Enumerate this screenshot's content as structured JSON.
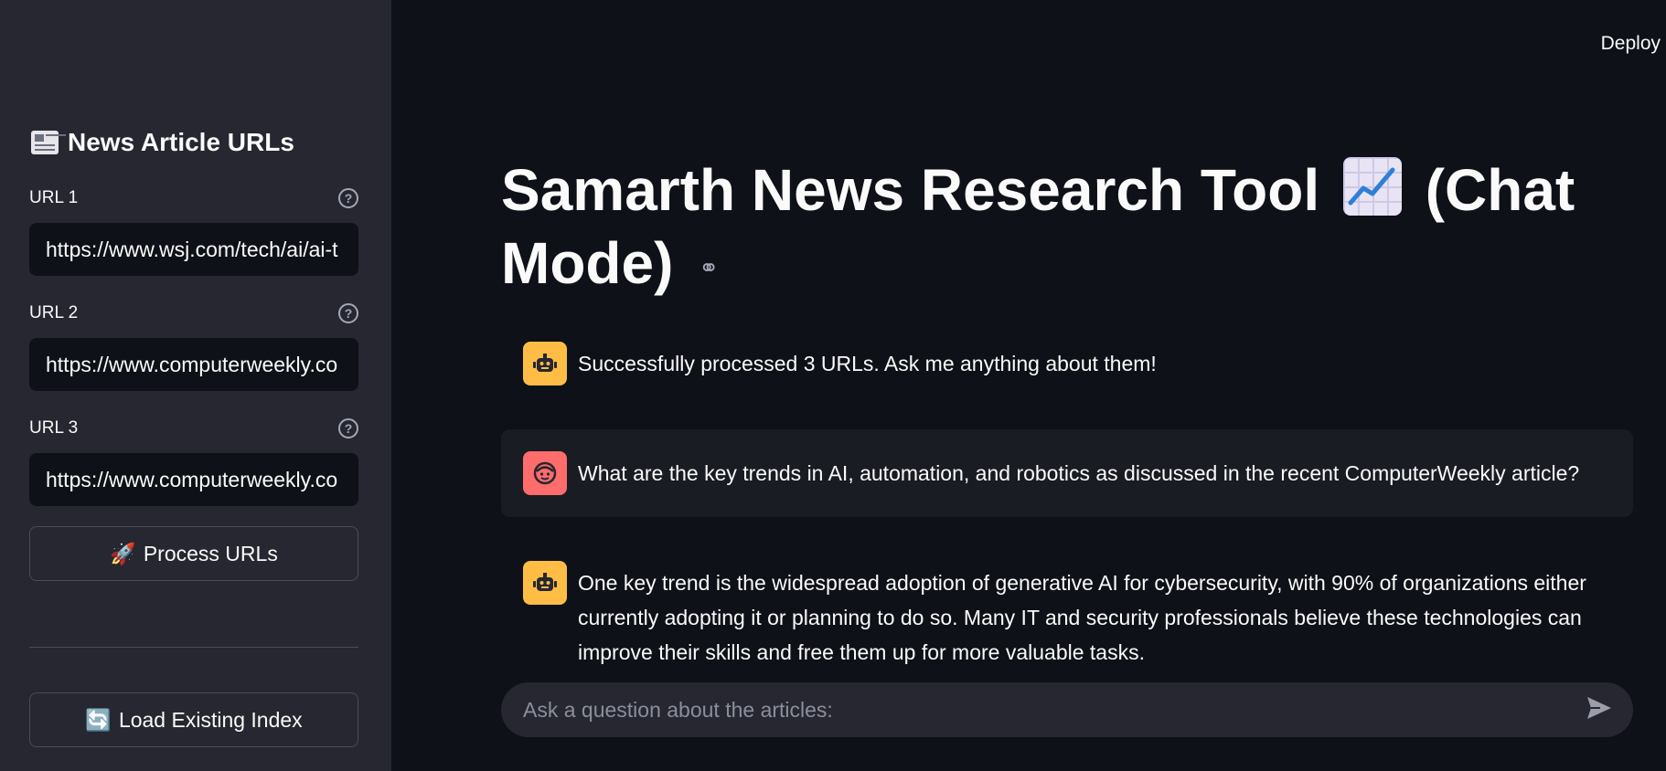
{
  "header": {
    "deploy_label": "Deploy"
  },
  "sidebar": {
    "title": "News Article URLs",
    "urls": [
      {
        "label": "URL 1",
        "value": "https://www.wsj.com/tech/ai/ai-t"
      },
      {
        "label": "URL 2",
        "value": "https://www.computerweekly.co"
      },
      {
        "label": "URL 3",
        "value": "https://www.computerweekly.co"
      }
    ],
    "process_button": {
      "icon": "🚀",
      "label": "Process URLs"
    },
    "load_button": {
      "icon": "🔄",
      "label": "Load Existing Index"
    }
  },
  "main": {
    "title_part1": "Samarth News Research Tool",
    "title_part2": "(Chat Mode)",
    "messages": [
      {
        "role": "assistant",
        "text": "Successfully processed 3 URLs. Ask me anything about them!"
      },
      {
        "role": "user",
        "text": "What are the key trends in AI, automation, and robotics as discussed in the recent ComputerWeekly article?"
      },
      {
        "role": "assistant",
        "text": "One key trend is the widespread adoption of generative AI for cybersecurity, with 90% of organizations either currently adopting it or planning to do so. Many IT and security professionals believe these technologies can improve their skills and free them up for more valuable tasks."
      }
    ],
    "chat_input": {
      "placeholder": "Ask a question about the articles:"
    }
  },
  "colors": {
    "sidebar_bg": "#262730",
    "main_bg": "#0e1117",
    "bot_avatar": "#ffbd45",
    "user_avatar": "#ff6c6c"
  },
  "icons": [
    "newspaper-icon",
    "help-icon",
    "rocket-icon",
    "refresh-icon",
    "chart-increasing-icon",
    "link-icon",
    "bot-icon",
    "user-face-icon",
    "send-icon"
  ]
}
